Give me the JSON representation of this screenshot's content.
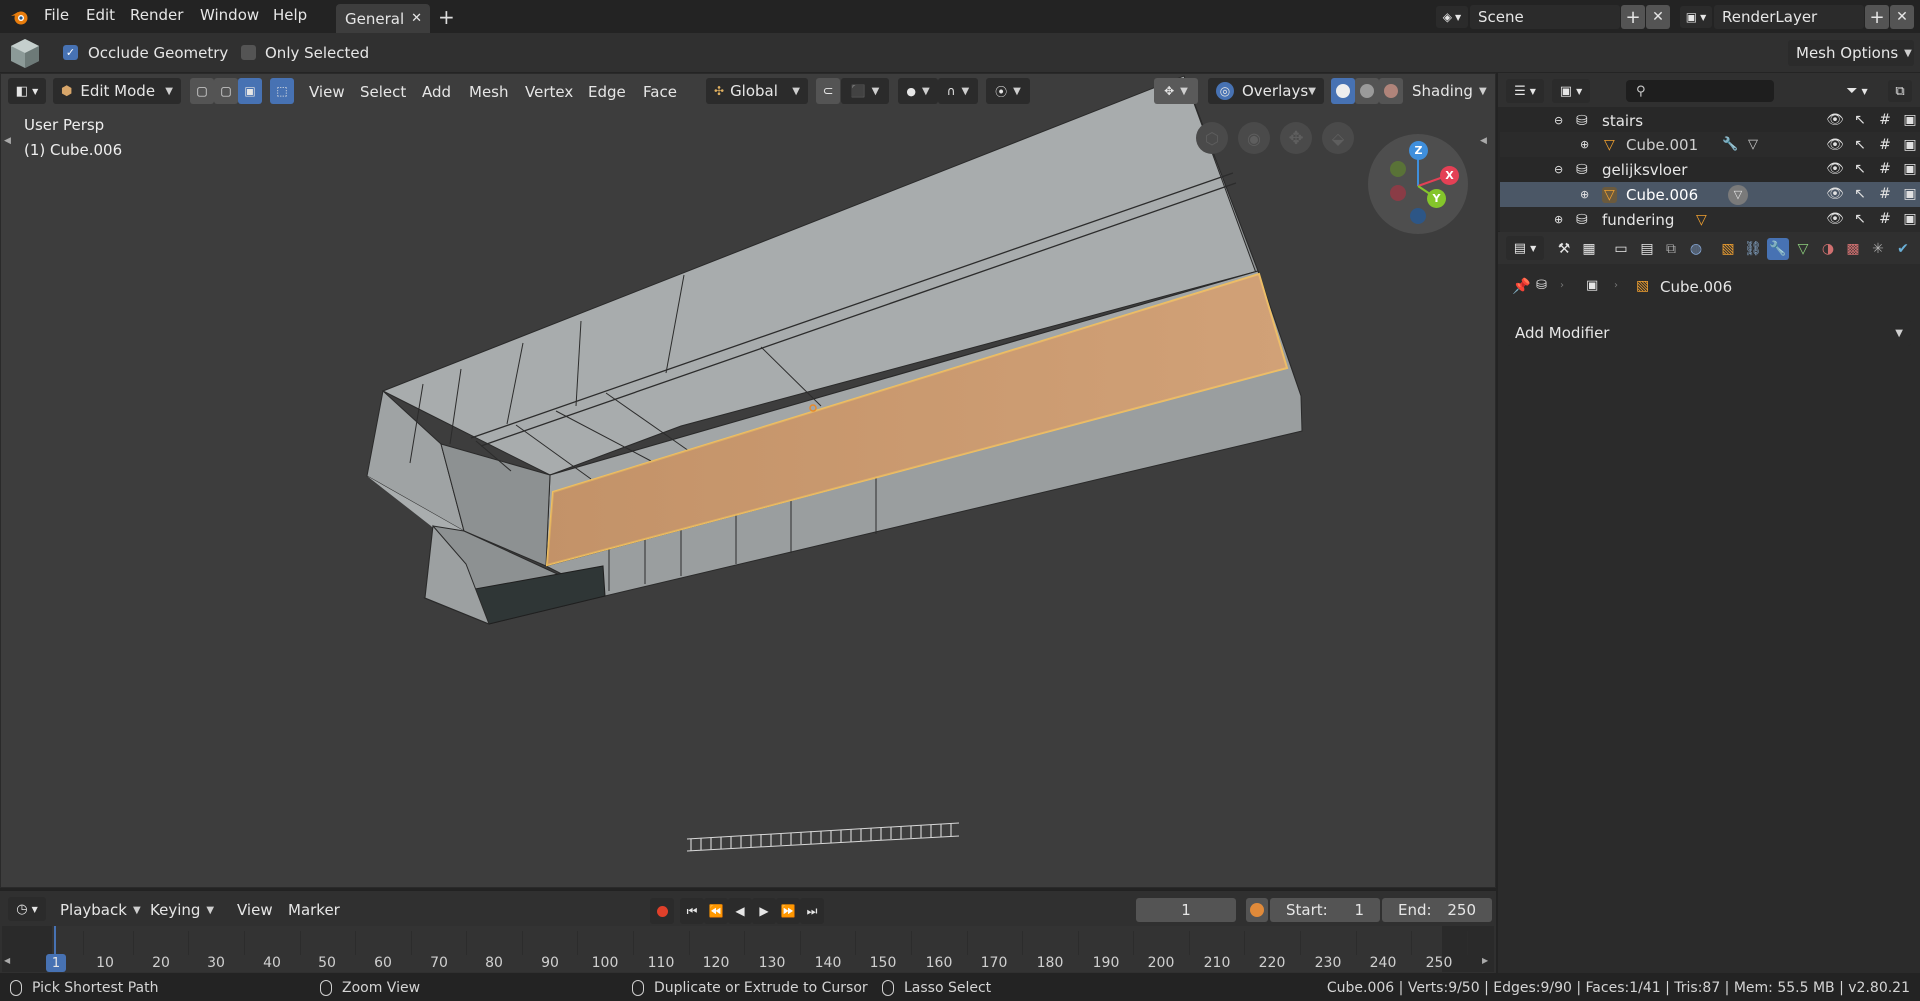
{
  "topbar": {
    "menus": [
      "File",
      "Edit",
      "Render",
      "Window",
      "Help"
    ],
    "workspace_tab": "General",
    "scene_label": "Scene",
    "renderlayer_label": "RenderLayer"
  },
  "toolsettings": {
    "occlude_geometry": "Occlude Geometry",
    "only_selected": "Only Selected",
    "mesh_options": "Mesh Options"
  },
  "viewport_header": {
    "mode": "Edit Mode",
    "menus": [
      "View",
      "Select",
      "Add",
      "Mesh",
      "Vertex",
      "Edge",
      "Face"
    ],
    "orientation": "Global",
    "overlays": "Overlays",
    "shading": "Shading"
  },
  "viewport": {
    "view_name": "User Persp",
    "object_info": "(1) Cube.006",
    "gizmo_axes": [
      "Z",
      "X",
      "Y"
    ]
  },
  "outliner": {
    "rows": [
      {
        "name": "stairs",
        "type": "collection"
      },
      {
        "name": "Cube.001",
        "type": "object"
      },
      {
        "name": "gelijksvloer",
        "type": "collection"
      },
      {
        "name": "Cube.006",
        "type": "object"
      },
      {
        "name": "fundering",
        "type": "collection"
      }
    ]
  },
  "properties": {
    "object_name": "Cube.006",
    "add_modifier": "Add Modifier"
  },
  "timeline": {
    "menus": [
      "Playback",
      "Keying",
      "View",
      "Marker"
    ],
    "current_frame": "1",
    "start_label": "Start:",
    "start_value": "1",
    "end_label": "End:",
    "end_value": "250",
    "ticks": [
      "1",
      "10",
      "20",
      "30",
      "40",
      "50",
      "60",
      "70",
      "80",
      "90",
      "100",
      "110",
      "120",
      "130",
      "140",
      "150",
      "160",
      "170",
      "180",
      "190",
      "200",
      "210",
      "220",
      "230",
      "240",
      "250"
    ]
  },
  "statusbar": {
    "hint1": "Pick Shortest Path",
    "hint2": "Zoom View",
    "hint3": "Duplicate or Extrude to Cursor",
    "hint4": "Lasso Select",
    "stats": "Cube.006 | Verts:9/50 | Edges:9/90 | Faces:1/41 | Tris:87 | Mem: 55.5 MB | v2.80.21"
  },
  "colors": {
    "accent": "#4772b3",
    "selected_face": "#d3a072",
    "selected_edge": "#f0c060",
    "viewport_bg": "#3d3d3d",
    "mesh_gray": "#a2a5a6"
  }
}
